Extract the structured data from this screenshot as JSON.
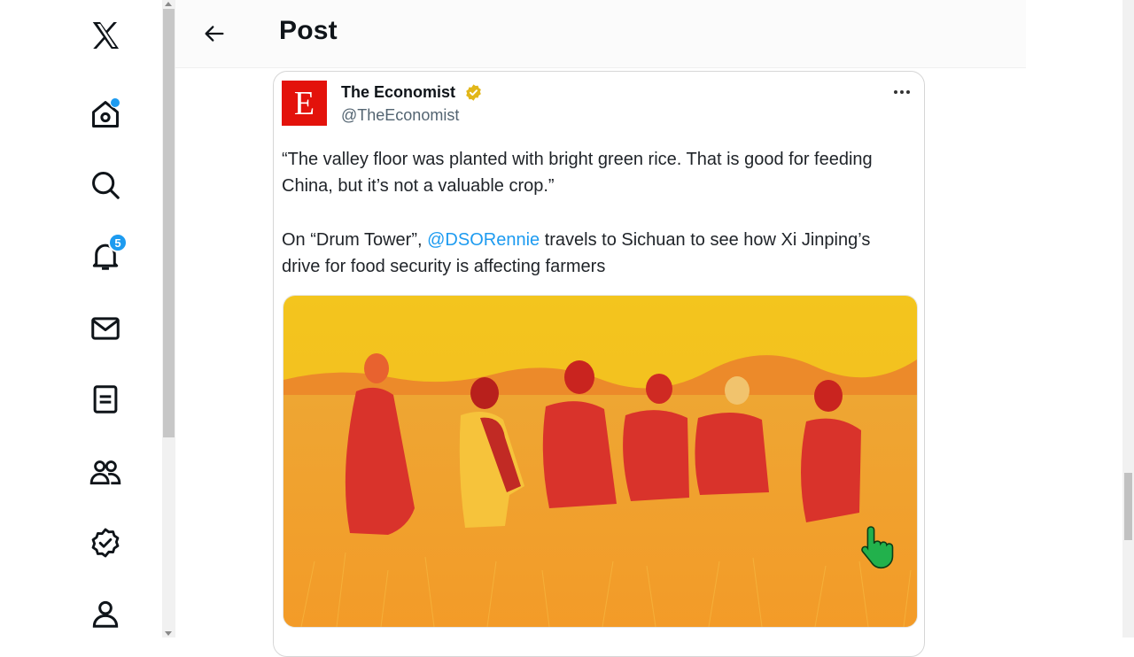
{
  "nav": {
    "items": [
      {
        "name": "x-logo-icon"
      },
      {
        "name": "home-icon",
        "has_dot": true
      },
      {
        "name": "search-icon"
      },
      {
        "name": "notifications-icon",
        "badge": "5"
      },
      {
        "name": "messages-icon"
      },
      {
        "name": "lists-icon"
      },
      {
        "name": "communities-icon"
      },
      {
        "name": "verified-icon"
      },
      {
        "name": "profile-icon"
      }
    ]
  },
  "header": {
    "title": "Post",
    "back_icon": "arrow-left-icon"
  },
  "post": {
    "avatar_letter": "E",
    "author_name": "The Economist",
    "author_handle": "@TheEconomist",
    "verified_icon": "gold-verified-badge-icon",
    "more_icon": "more-horizontal-icon",
    "paragraph_1": "“The valley floor was planted with bright green rice. That is good for feeding China, but it’s not a valuable crop.”",
    "paragraph_2_prefix": "On “Drum Tower”, ",
    "mention": "@DSORennie",
    "paragraph_2_suffix": " travels to Sichuan to see how Xi Jinping’s drive for food security is affecting farmers"
  },
  "colors": {
    "accent": "#1d9bf0",
    "economist_red": "#e3120b",
    "verified_gold": "#e2b719",
    "image_sky": "#f2c21d",
    "image_field": "#f0a02c"
  }
}
